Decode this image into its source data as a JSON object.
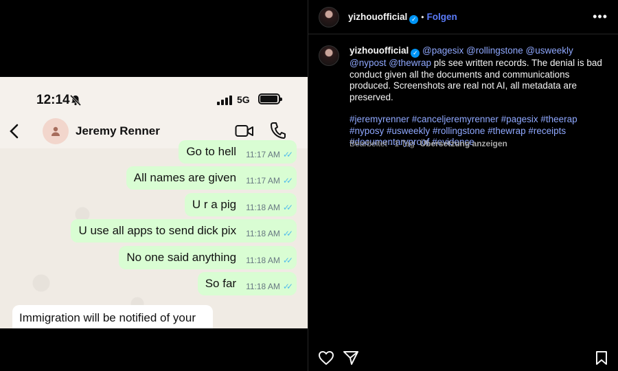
{
  "screenshot": {
    "time": "12:14",
    "network": "5G",
    "contact_name": "Jeremy Renner",
    "messages": [
      {
        "text": "Go to hell",
        "time": "11:17 AM"
      },
      {
        "text": "All names are given",
        "time": "11:17 AM"
      },
      {
        "text": "U r a pig",
        "time": "11:18 AM"
      },
      {
        "text": "U use all apps to send dick pix",
        "time": "11:18 AM"
      },
      {
        "text": "No one said anything",
        "time": "11:18 AM"
      },
      {
        "text": "So far",
        "time": "11:18 AM"
      }
    ],
    "incoming_text": "Immigration will be notified of your"
  },
  "post": {
    "username": "yizhouofficial",
    "follow_label": "Folgen",
    "caption": {
      "mentions": "@pagesix @rollingstone @usweekly @nypost @thewrap",
      "body": " pls see written records. The denial is bad conduct given all the documents and communications produced. Screenshots are real not AI, all metadata are preserved.",
      "hashtags": "#jeremyrenner #canceljeremyrenner #pagesix #theerap #nyposy #usweekly #rollingstone #thewrap #receipts #documentaryproof #evidence"
    },
    "edited_label": "Bearbeitet · 1 Tag",
    "translate_label": "Übersetzung anzeigen"
  },
  "colors": {
    "bubble": "#d9fdd3",
    "ticks": "#53bdeb",
    "link": "#8fa8ff",
    "verified": "#0095f6"
  }
}
